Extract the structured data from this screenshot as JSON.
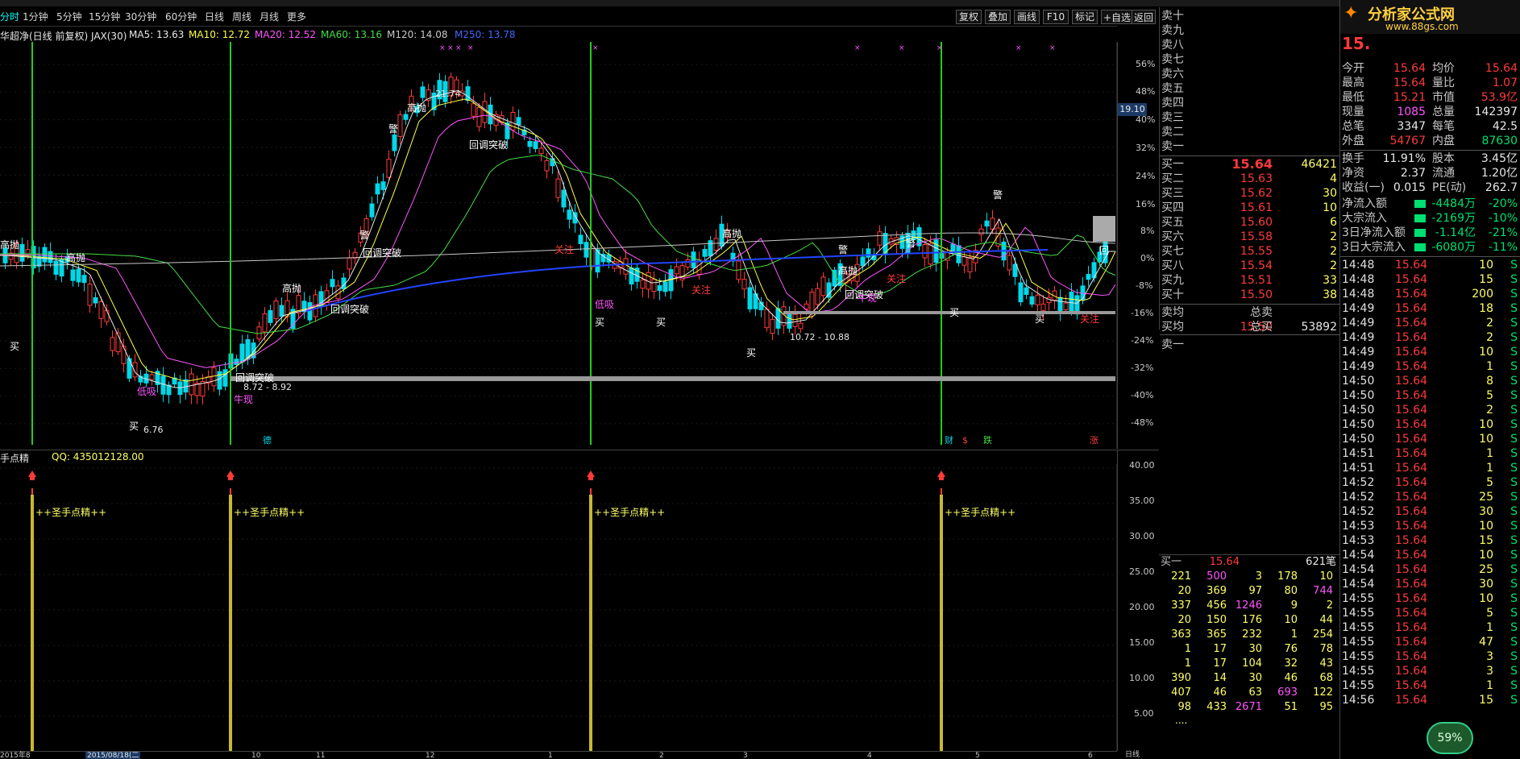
{
  "top_toolbar": {
    "items": [
      "",
      "",
      "",
      "",
      "",
      "",
      "",
      "",
      "",
      "",
      "",
      "",
      ""
    ]
  },
  "period_bar": {
    "tabs": [
      "分时",
      "1分钟",
      "5分钟",
      "15分钟",
      "30分钟",
      "60分钟",
      "日线",
      "周线",
      "月线",
      "更多"
    ],
    "active": "日线",
    "right_buttons": [
      "复权",
      "叠加",
      "画线",
      "F10",
      "标记",
      "+自选",
      "返回"
    ]
  },
  "indicator_header": {
    "title": "华超净(日线 前复权) JAX(30)",
    "ma5": "MA5: 13.63",
    "ma10": "MA10: 12.72",
    "ma20": "MA20: 12.52",
    "ma60": "MA60: 13.16",
    "ma120": "M120: 14.08",
    "ma250": "M250: 13.78",
    "colors": {
      "ma5": "#e8e8e8",
      "ma10": "#ffff44",
      "ma20": "#ff55ff",
      "ma60": "#44dd44",
      "ma120": "#c8c8c8",
      "ma250": "#4466ff"
    }
  },
  "main_axis": {
    "pct_labels": [
      "56%",
      "48%",
      "40%",
      "32%",
      "24%",
      "16%",
      "8%",
      "0%",
      "-8%",
      "-16%",
      "-24%",
      "-32%",
      "-40%",
      "-48%"
    ],
    "price_tag": "19.10"
  },
  "annotations": {
    "labels": [
      "高抛",
      "高抛",
      "高抛",
      "高抛",
      "高抛",
      "高抛",
      "回调突破",
      "回调突破",
      "回调突破",
      "回调突破",
      "回调突破",
      "买",
      "买",
      "买",
      "买",
      "买",
      "买",
      "买",
      "低吸",
      "低吸",
      "关注",
      "关注",
      "关注",
      "关注",
      "牛现",
      "牛现",
      "警",
      "警",
      "警",
      "警",
      "警",
      "回"
    ],
    "price_notes": [
      "21.74",
      "6.76",
      "8.72 - 8.92",
      "10.72 - 10.88"
    ]
  },
  "lower_pane": {
    "title": "手点精",
    "qq": "QQ: 435012128.00",
    "signal_label": "++圣手点精++",
    "axis": [
      "40.00",
      "35.00",
      "30.00",
      "25.00",
      "20.00",
      "15.00",
      "10.00",
      "5.00"
    ]
  },
  "date_bar": {
    "labels": [
      "2015年8",
      "2015/08/18(二",
      "10",
      "11",
      "12",
      "1",
      "2",
      "3",
      "4",
      "5",
      "6"
    ],
    "period": "日线"
  },
  "event_marks": [
    "德",
    "财",
    "$",
    "跌",
    "涨"
  ],
  "order_book": {
    "asks": [
      {
        "label": "卖十",
        "price": "",
        "vol": ""
      },
      {
        "label": "卖九",
        "price": "",
        "vol": ""
      },
      {
        "label": "卖八",
        "price": "",
        "vol": ""
      },
      {
        "label": "卖七",
        "price": "",
        "vol": ""
      },
      {
        "label": "卖六",
        "price": "",
        "vol": ""
      },
      {
        "label": "卖五",
        "price": "",
        "vol": ""
      },
      {
        "label": "卖四",
        "price": "",
        "vol": ""
      },
      {
        "label": "卖三",
        "price": "",
        "vol": ""
      },
      {
        "label": "卖二",
        "price": "",
        "vol": ""
      },
      {
        "label": "卖一",
        "price": "",
        "vol": ""
      }
    ],
    "bids": [
      {
        "label": "买一",
        "price": "15.64",
        "vol": "46421"
      },
      {
        "label": "买二",
        "price": "15.63",
        "vol": "4"
      },
      {
        "label": "买三",
        "price": "15.62",
        "vol": "30"
      },
      {
        "label": "买四",
        "price": "15.61",
        "vol": "10"
      },
      {
        "label": "买五",
        "price": "15.60",
        "vol": "6"
      },
      {
        "label": "买六",
        "price": "15.58",
        "vol": "2"
      },
      {
        "label": "买七",
        "price": "15.55",
        "vol": "2"
      },
      {
        "label": "买八",
        "price": "15.54",
        "vol": "2"
      },
      {
        "label": "买九",
        "price": "15.51",
        "vol": "33"
      },
      {
        "label": "买十",
        "price": "15.50",
        "vol": "38"
      }
    ],
    "summary": [
      {
        "label": "卖均",
        "value": "",
        "label2": "总卖",
        "value2": ""
      },
      {
        "label": "买均",
        "value": "15.50",
        "label2": "总买",
        "value2": "53892"
      }
    ],
    "ask_one_label": "卖一"
  },
  "quote_panel": {
    "logo_text": "分析家公式网",
    "logo_url": "www.88gs.com",
    "price_line": "15.",
    "stats": [
      {
        "l": "今开",
        "v": "15.64",
        "l2": "均价",
        "v2": "15.64"
      },
      {
        "l": "最高",
        "v": "15.64",
        "l2": "量比",
        "v2": "1.07"
      },
      {
        "l": "最低",
        "v": "15.21",
        "l2": "市值",
        "v2": "53.9亿"
      },
      {
        "l": "现量",
        "v": "1085",
        "l2": "总量",
        "v2": "142397"
      },
      {
        "l": "总笔",
        "v": "3347",
        "l2": "每笔",
        "v2": "42.5"
      },
      {
        "l": "外盘",
        "v": "54767",
        "l2": "内盘",
        "v2": "87630"
      }
    ],
    "stats2": [
      {
        "l": "换手",
        "v": "11.91%",
        "l2": "股本",
        "v2": "3.45亿"
      },
      {
        "l": "净资",
        "v": "2.37",
        "l2": "流通",
        "v2": "1.20亿"
      },
      {
        "l": "收益(一)",
        "v": "0.015",
        "l2": "PE(动)",
        "v2": "262.7"
      }
    ],
    "flows": [
      {
        "l": "净流入额",
        "v": "-4484万",
        "pct": "-20%"
      },
      {
        "l": "大宗流入",
        "v": "-2169万",
        "pct": "-10%"
      },
      {
        "l": "3日净流入额",
        "v": "-1.14亿",
        "pct": "-21%"
      },
      {
        "l": "3日大宗流入",
        "v": "-6080万",
        "pct": "-11%"
      }
    ],
    "ticks": [
      {
        "t": "14:48",
        "p": "15.64",
        "v": "10",
        "s": "S"
      },
      {
        "t": "14:48",
        "p": "15.64",
        "v": "15",
        "s": "S"
      },
      {
        "t": "14:48",
        "p": "15.64",
        "v": "200",
        "s": "S"
      },
      {
        "t": "14:49",
        "p": "15.64",
        "v": "18",
        "s": "S"
      },
      {
        "t": "14:49",
        "p": "15.64",
        "v": "2",
        "s": "S"
      },
      {
        "t": "14:49",
        "p": "15.64",
        "v": "2",
        "s": "S"
      },
      {
        "t": "14:49",
        "p": "15.64",
        "v": "10",
        "s": "S"
      },
      {
        "t": "14:49",
        "p": "15.64",
        "v": "1",
        "s": "S"
      },
      {
        "t": "14:50",
        "p": "15.64",
        "v": "8",
        "s": "S"
      },
      {
        "t": "14:50",
        "p": "15.64",
        "v": "5",
        "s": "S"
      },
      {
        "t": "14:50",
        "p": "15.64",
        "v": "2",
        "s": "S"
      },
      {
        "t": "14:50",
        "p": "15.64",
        "v": "10",
        "s": "S"
      },
      {
        "t": "14:50",
        "p": "15.64",
        "v": "10",
        "s": "S"
      },
      {
        "t": "14:51",
        "p": "15.64",
        "v": "1",
        "s": "S"
      },
      {
        "t": "14:51",
        "p": "15.64",
        "v": "1",
        "s": "S"
      },
      {
        "t": "14:52",
        "p": "15.64",
        "v": "5",
        "s": "S"
      },
      {
        "t": "14:52",
        "p": "15.64",
        "v": "25",
        "s": "S"
      },
      {
        "t": "14:52",
        "p": "15.64",
        "v": "30",
        "s": "S"
      },
      {
        "t": "14:53",
        "p": "15.64",
        "v": "10",
        "s": "S"
      },
      {
        "t": "14:53",
        "p": "15.64",
        "v": "15",
        "s": "S"
      },
      {
        "t": "14:54",
        "p": "15.64",
        "v": "10",
        "s": "S"
      },
      {
        "t": "14:54",
        "p": "15.64",
        "v": "25",
        "s": "S"
      },
      {
        "t": "14:54",
        "p": "15.64",
        "v": "30",
        "s": "S"
      },
      {
        "t": "14:55",
        "p": "15.64",
        "v": "10",
        "s": "S"
      },
      {
        "t": "14:55",
        "p": "15.64",
        "v": "5",
        "s": "S"
      },
      {
        "t": "14:55",
        "p": "15.64",
        "v": "1",
        "s": "S"
      },
      {
        "t": "14:55",
        "p": "15.64",
        "v": "47",
        "s": "S"
      },
      {
        "t": "14:55",
        "p": "15.64",
        "v": "3",
        "s": "S"
      },
      {
        "t": "14:55",
        "p": "15.64",
        "v": "3",
        "s": "S"
      },
      {
        "t": "14:55",
        "p": "15.64",
        "v": "1",
        "s": "S"
      },
      {
        "t": "14:56",
        "p": "15.64",
        "v": "15",
        "s": "S"
      }
    ],
    "badge": "59%"
  },
  "trade_table": {
    "header": {
      "label": "买一",
      "price": "15.64",
      "count": "621笔"
    },
    "rows": [
      [
        "221",
        "500",
        "3",
        "178",
        "10"
      ],
      [
        "20",
        "369",
        "97",
        "80",
        "744"
      ],
      [
        "337",
        "456",
        "1246",
        "9",
        "2"
      ],
      [
        "20",
        "150",
        "176",
        "10",
        "44"
      ],
      [
        "363",
        "365",
        "232",
        "1",
        "254"
      ],
      [
        "1",
        "17",
        "30",
        "76",
        "78"
      ],
      [
        "1",
        "17",
        "104",
        "32",
        "43"
      ],
      [
        "390",
        "14",
        "30",
        "46",
        "68"
      ],
      [
        "407",
        "46",
        "63",
        "693",
        "122"
      ],
      [
        "98",
        "433",
        "2671",
        "51",
        "95"
      ]
    ],
    "ellipsis": "....",
    "highlight_cells": [
      "500",
      "1246",
      "693",
      "2671",
      "744"
    ]
  }
}
